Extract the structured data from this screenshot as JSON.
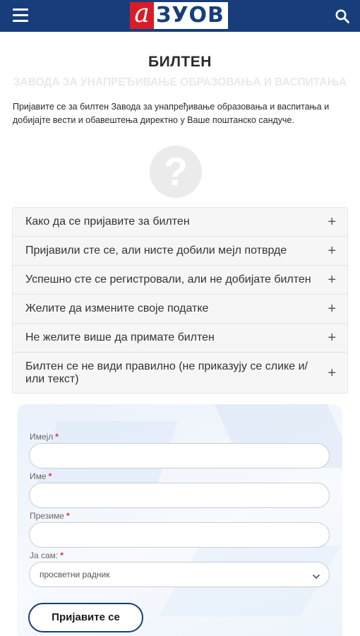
{
  "header": {
    "logo_mark": "а",
    "logo_text": "ЗУОВ",
    "brand_color": "#173e7a",
    "accent_color": "#d71d2a",
    "menu_icon": "hamburger-icon",
    "search_icon": "search-icon"
  },
  "page": {
    "title": "БИЛТЕН",
    "subtitle": "ЗАВОДА ЗА УНАПРЕЂИВАЊЕ ОБРАЗОВАЊА И ВАСПИТАЊА",
    "intro": "Пријавите се за билтен Завода за унапређивање образовања и васпитања и добијајте вести и обавештења директно у Ваше поштанско сандуче.",
    "help_icon": "question-mark-icon",
    "help_glyph": "?"
  },
  "faq": {
    "expand_glyph": "+",
    "items": [
      {
        "label": "Како да се пријавите за билтен"
      },
      {
        "label": "Пријавили сте се, али нисте добили мејл потврде"
      },
      {
        "label": "Успешно сте се регистровали, али не добијате билтен"
      },
      {
        "label": "Желите да измените своје податке"
      },
      {
        "label": "Не желите више да примате билтен"
      },
      {
        "label": "Билтен се не види правилно (не приказују се слике и/или текст)"
      }
    ]
  },
  "form": {
    "required_mark": "*",
    "email_label": "Имејл",
    "email_value": "",
    "first_name_label": "Име",
    "first_name_value": "",
    "last_name_label": "Презиме",
    "last_name_value": "",
    "role_label": "Ја сам:",
    "role_selected": "просветни радник",
    "submit_label": "Пријавите се"
  }
}
